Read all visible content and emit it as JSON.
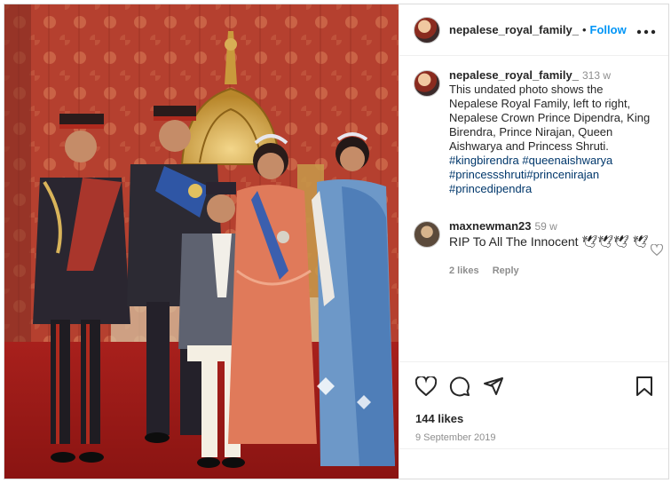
{
  "post": {
    "username": "nepalese_royal_family_",
    "dot": "•",
    "follow_label": "Follow",
    "more_label": "•••"
  },
  "caption": {
    "username": "nepalese_royal_family_",
    "time": "313 w",
    "text": "This undated photo shows the Nepalese Royal Family, left to right, Nepalese Crown Prince Dipendra, King Birendra, Prince Nirajan, Queen Aishwarya and Princess Shruti.",
    "tags": [
      "#kingbirendra #queenaishwarya",
      "#princessshruti#princenirajan",
      "#princedipendra"
    ]
  },
  "comment": {
    "username": "maxnewman23",
    "time": "59 w",
    "text": "RIP To All The Innocent 🕊🕊🕊 🕊",
    "likes": "2 likes",
    "reply_label": "Reply"
  },
  "actions": {
    "likes_count": "144 likes",
    "date": "9 September 2019"
  },
  "icons": {
    "heart": "heart-icon",
    "comment": "comment-icon",
    "share": "share-icon",
    "save": "bookmark-icon",
    "more": "more-options-icon"
  }
}
